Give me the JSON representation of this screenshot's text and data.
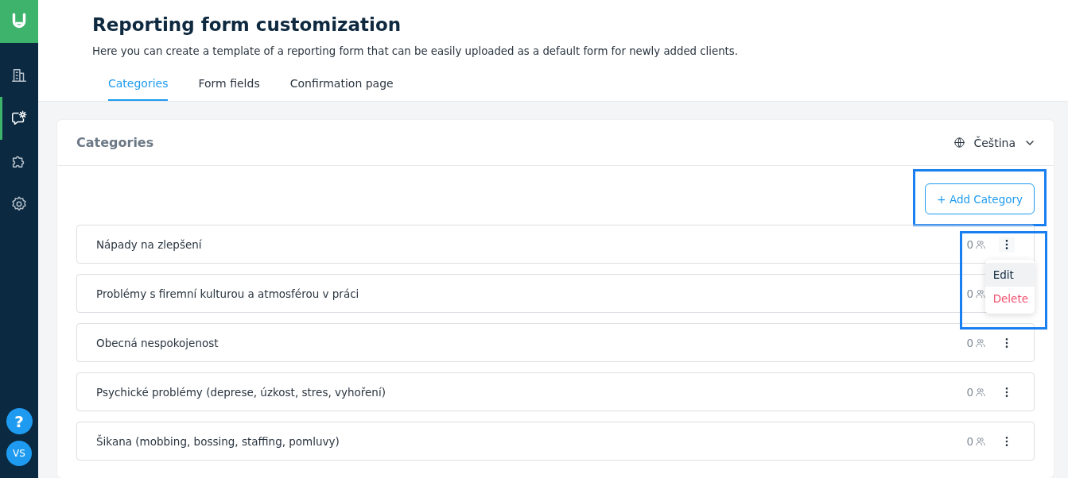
{
  "sidebar": {
    "items": [
      {
        "kind": "building",
        "selected": false
      },
      {
        "kind": "chat-gear",
        "selected": true
      },
      {
        "kind": "puzzle",
        "selected": false
      },
      {
        "kind": "gear",
        "selected": false
      }
    ],
    "help": "?",
    "avatar": "VS"
  },
  "page": {
    "title": "Reporting form customization",
    "subtitle": "Here you can create a template of a reporting form that can be easily uploaded as a default form for newly added clients."
  },
  "tabs": [
    {
      "label": "Categories",
      "selected": true
    },
    {
      "label": "Form fields",
      "selected": false
    },
    {
      "label": "Confirmation page",
      "selected": false
    }
  ],
  "card": {
    "title": "Categories",
    "language": "Čeština",
    "add_button": "+ Add Category"
  },
  "categories": [
    {
      "name": "Nápady na zlepšení",
      "count": "0",
      "menu_open": true
    },
    {
      "name": "Problémy s firemní kulturou a atmosférou v práci",
      "count": "0",
      "menu_open": false
    },
    {
      "name": "Obecná nespokojenost",
      "count": "0",
      "menu_open": false
    },
    {
      "name": "Psychické problémy (deprese, úzkost, stres, vyhoření)",
      "count": "0",
      "menu_open": false
    },
    {
      "name": "Šikana (mobbing, bossing, staffing, pomluvy)",
      "count": "0",
      "menu_open": false
    }
  ],
  "row_menu": [
    {
      "label": "Edit",
      "kind": "normal",
      "hovered": true
    },
    {
      "label": "Delete",
      "kind": "danger",
      "hovered": false
    }
  ]
}
